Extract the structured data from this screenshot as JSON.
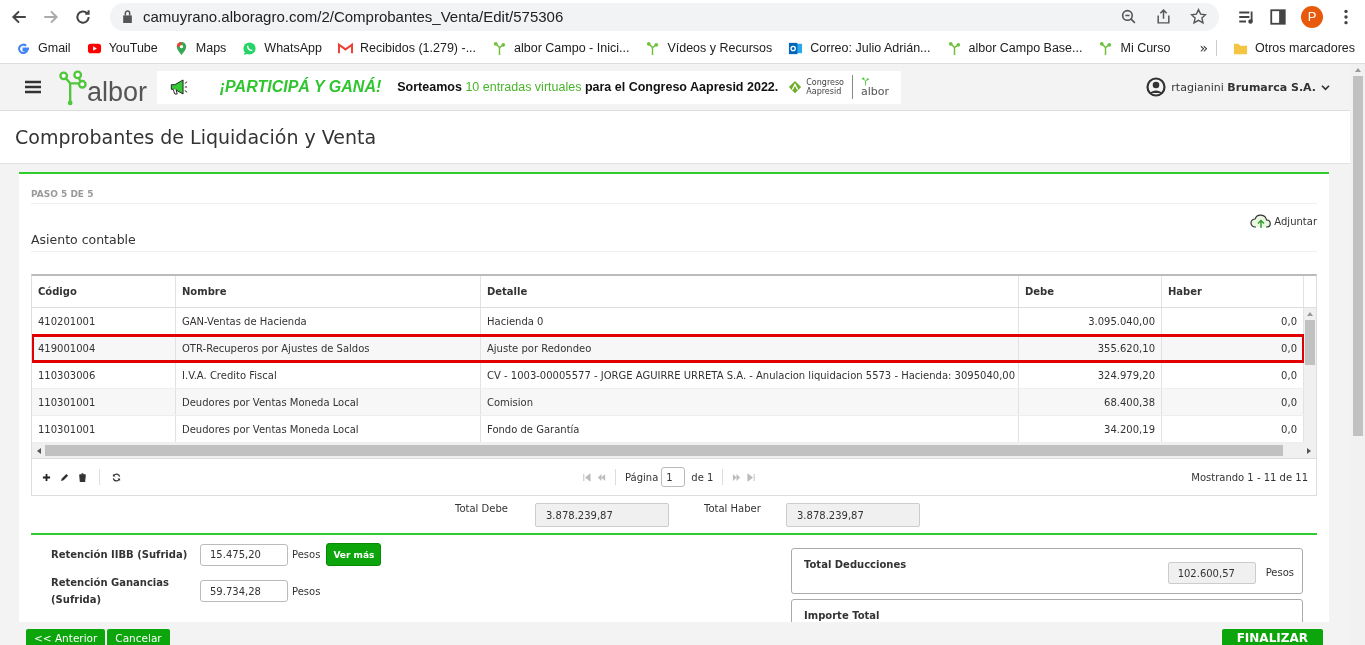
{
  "browser": {
    "url": "camuyrano.alboragro.com/2/Comprobantes_Venta/Edit/575306",
    "profile": "P",
    "bookmarks": [
      {
        "label": "Gmail",
        "kind": "google"
      },
      {
        "label": "YouTube",
        "kind": "youtube"
      },
      {
        "label": "Maps",
        "kind": "maps"
      },
      {
        "label": "WhatsApp",
        "kind": "whatsapp"
      },
      {
        "label": "Recibidos (1.279) -...",
        "kind": "gmail"
      },
      {
        "label": "albor Campo - Inici...",
        "kind": "albor"
      },
      {
        "label": "Vídeos y Recursos",
        "kind": "albor"
      },
      {
        "label": "Correo: Julio Adrián...",
        "kind": "outlook"
      },
      {
        "label": "albor Campo Base...",
        "kind": "albor"
      },
      {
        "label": "Mi Curso",
        "kind": "albor"
      }
    ],
    "overflow": "»",
    "other_bookmarks": "Otros marcadores"
  },
  "header": {
    "logo": "albor",
    "banner": {
      "headline": "¡PARTICIPÁ Y GANÁ!",
      "text_before": "Sorteamos",
      "highlight": "10 entradas virtuales",
      "text_after": "para el Congreso Aapresid 2022.",
      "partner_line1": "Congreso",
      "partner_line2": "Aapresid",
      "partner_logo": "albor"
    },
    "user": {
      "name": "rtagianini",
      "company": "Brumarca S.A."
    }
  },
  "page_title": "Comprobantes de Liquidación y Venta",
  "step": "PASO 5 DE 5",
  "attach": "Adjuntar",
  "section_title": "Asiento contable",
  "table": {
    "columns": [
      "Código",
      "Nombre",
      "Detalle",
      "Debe",
      "Haber"
    ],
    "rows": [
      {
        "cells": [
          "410201001",
          "GAN-Ventas de Hacienda",
          "Hacienda 0",
          "3.095.040,00",
          "0,0"
        ],
        "highlighted": false
      },
      {
        "cells": [
          "419001004",
          "OTR-Recuperos por Ajustes de Saldos",
          "Ajuste por Redondeo",
          "355.620,10",
          "0,0"
        ],
        "highlighted": true
      },
      {
        "cells": [
          "110303006",
          "I.V.A. Credito Fiscal",
          "CV - 1003-00005577 - JORGE AGUIRRE URRETA  S.A. - Anulacion liquidacion 5573 - Hacienda: 3095040,00",
          "324.979,20",
          "0,0"
        ],
        "highlighted": false
      },
      {
        "cells": [
          "110301001",
          "Deudores por Ventas Moneda Local",
          "Comision",
          "68.400,38",
          "0,0"
        ],
        "highlighted": false
      },
      {
        "cells": [
          "110301001",
          "Deudores por Ventas Moneda Local",
          "Fondo de Garantía",
          "34.200,19",
          "0,0"
        ],
        "highlighted": false
      }
    ]
  },
  "pager": {
    "page_label": "Página",
    "page": "1",
    "of": "de 1",
    "showing": "Mostrando 1 - 11 de 11"
  },
  "totals": [
    {
      "label": "Total Debe",
      "value": "3.878.239,87"
    },
    {
      "label": "Total Haber",
      "value": "3.878.239,87"
    }
  ],
  "deductions": [
    {
      "label": "Retención IIBB (Sufrida)",
      "value": "15.475,20",
      "unit": "Pesos",
      "action": "Ver más"
    },
    {
      "label": "Retención Ganancias (Sufrida)",
      "value": "59.734,28",
      "unit": "Pesos"
    }
  ],
  "summary": [
    {
      "label": "Total Deducciones",
      "value": "102.600,57",
      "unit": "Pesos"
    },
    {
      "label": "Importe Total"
    }
  ],
  "footer_buttons": [
    {
      "label": "<< Anterior"
    },
    {
      "label": "Cancelar"
    },
    {
      "label": "FINALIZAR"
    }
  ]
}
